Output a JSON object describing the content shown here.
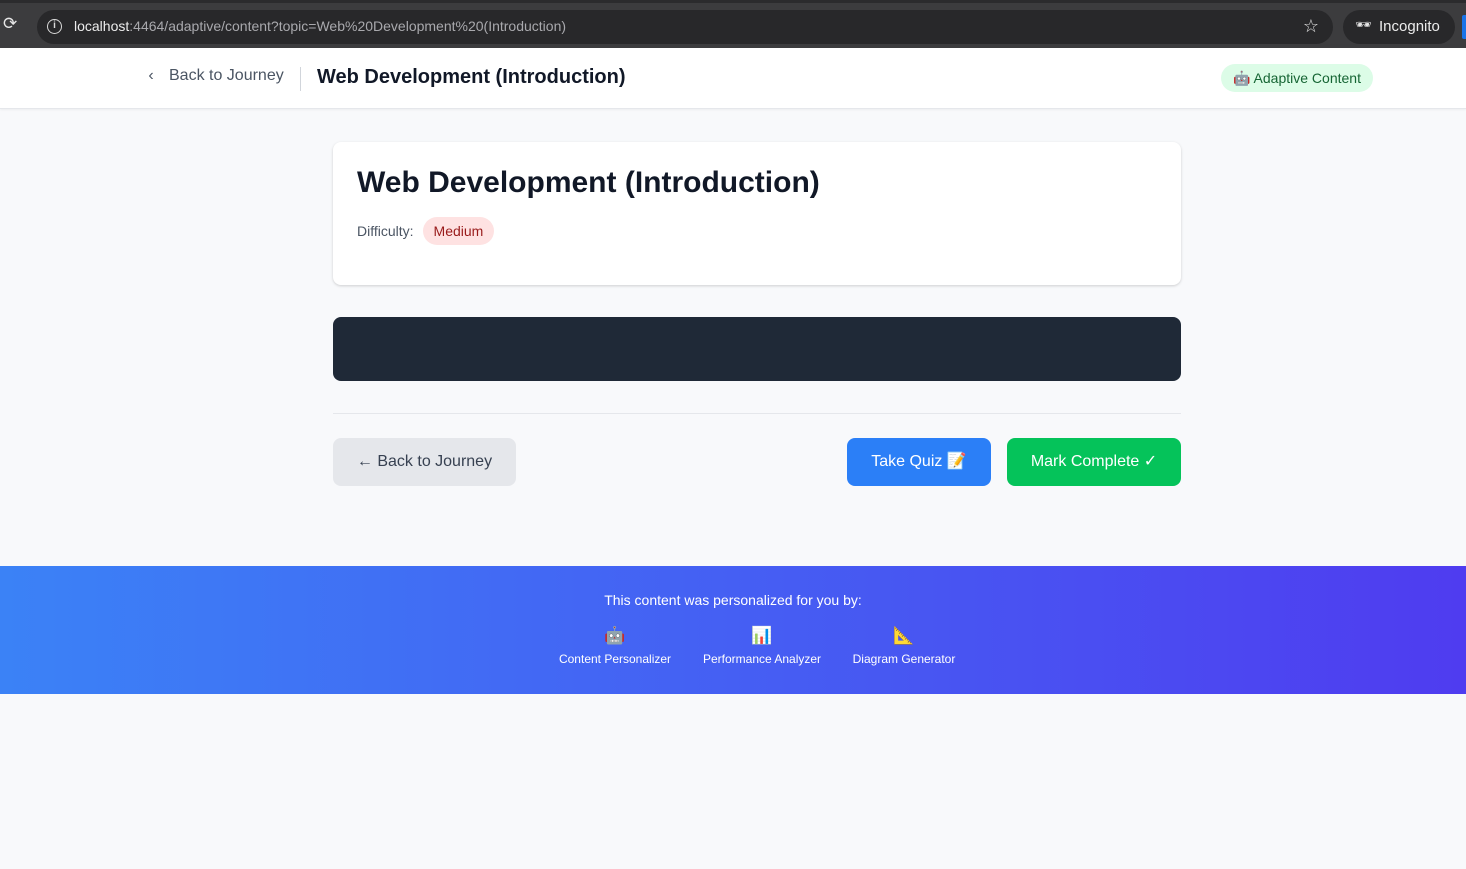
{
  "browser": {
    "url_host": "localhost",
    "url_rest": ":4464/adaptive/content?topic=Web%20Development%20(Introduction)",
    "incognito_label": "Incognito"
  },
  "header": {
    "back_label": "Back to Journey",
    "title": "Web Development (Introduction)",
    "badge": "🤖 Adaptive Content"
  },
  "content": {
    "title": "Web Development (Introduction)",
    "difficulty_label": "Difficulty:",
    "difficulty_value": "Medium"
  },
  "actions": {
    "back_label": "← Back to Journey",
    "quiz_label": "Take Quiz 📝",
    "complete_label": "Mark Complete ✓"
  },
  "footer": {
    "caption": "This content was personalized for you by:",
    "agents": [
      {
        "icon": "🤖",
        "icon_name": "robot-icon",
        "label": "Content Personalizer"
      },
      {
        "icon": "📊",
        "icon_name": "bar-chart-icon",
        "label": "Performance Analyzer"
      },
      {
        "icon": "📐",
        "icon_name": "triangle-ruler-icon",
        "label": "Diagram Generator"
      }
    ]
  },
  "colors": {
    "primary": "#2b7ff7",
    "success": "#05c35a",
    "code_bg": "#1f2937",
    "footer_gradient_start": "#3b82f6",
    "footer_gradient_end": "#4f3cf0"
  }
}
